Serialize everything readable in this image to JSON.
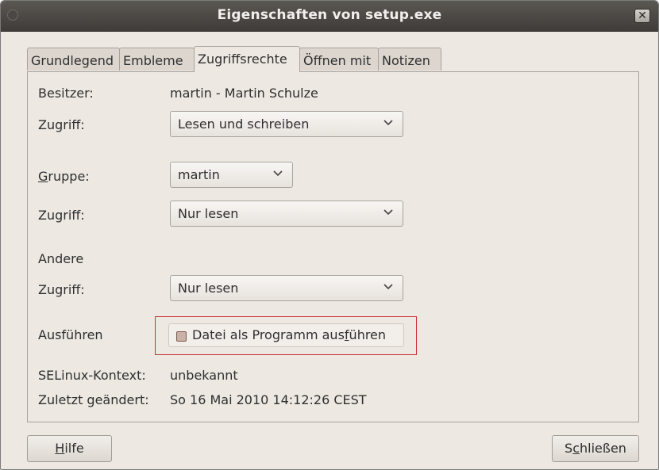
{
  "window": {
    "title": "Eigenschaften von setup.exe"
  },
  "tabs": [
    {
      "label": "Grundlegend",
      "active": false
    },
    {
      "label": "Embleme",
      "active": false
    },
    {
      "label": "Zugriffsrechte",
      "active": true
    },
    {
      "label": "Öffnen mit",
      "active": false
    },
    {
      "label": "Notizen",
      "active": false
    }
  ],
  "owner": {
    "label": "Besitzer:",
    "value": "martin - Martin Schulze",
    "access_label": "Zugriff:",
    "access_value": "Lesen und schreiben"
  },
  "group": {
    "label_mnemonic": "G",
    "label_rest": "ruppe:",
    "value": "martin",
    "access_label": "Zugriff:",
    "access_value": "Nur lesen"
  },
  "others": {
    "label": "Andere",
    "access_label": "Zugriff:",
    "access_value": "Nur lesen"
  },
  "execute": {
    "label": "Ausführen",
    "checkbox_text_pre": "Datei als Programm aus",
    "checkbox_text_mnemonic": "f",
    "checkbox_text_post": "ühren",
    "checked": true
  },
  "selinux": {
    "label": "SELinux-Kontext:",
    "value": "unbekannt"
  },
  "modified": {
    "label": "Zuletzt geändert:",
    "value": "So 16 Mai 2010 14:12:26 CEST"
  },
  "buttons": {
    "help": {
      "mnemonic": "H",
      "rest": "ilfe"
    },
    "close": {
      "pre": "S",
      "mnemonic": "c",
      "rest": "hließen"
    }
  },
  "colors": {
    "focus_border": "#c93535",
    "titlebar": "#4a4744",
    "background": "#ede8e2"
  }
}
